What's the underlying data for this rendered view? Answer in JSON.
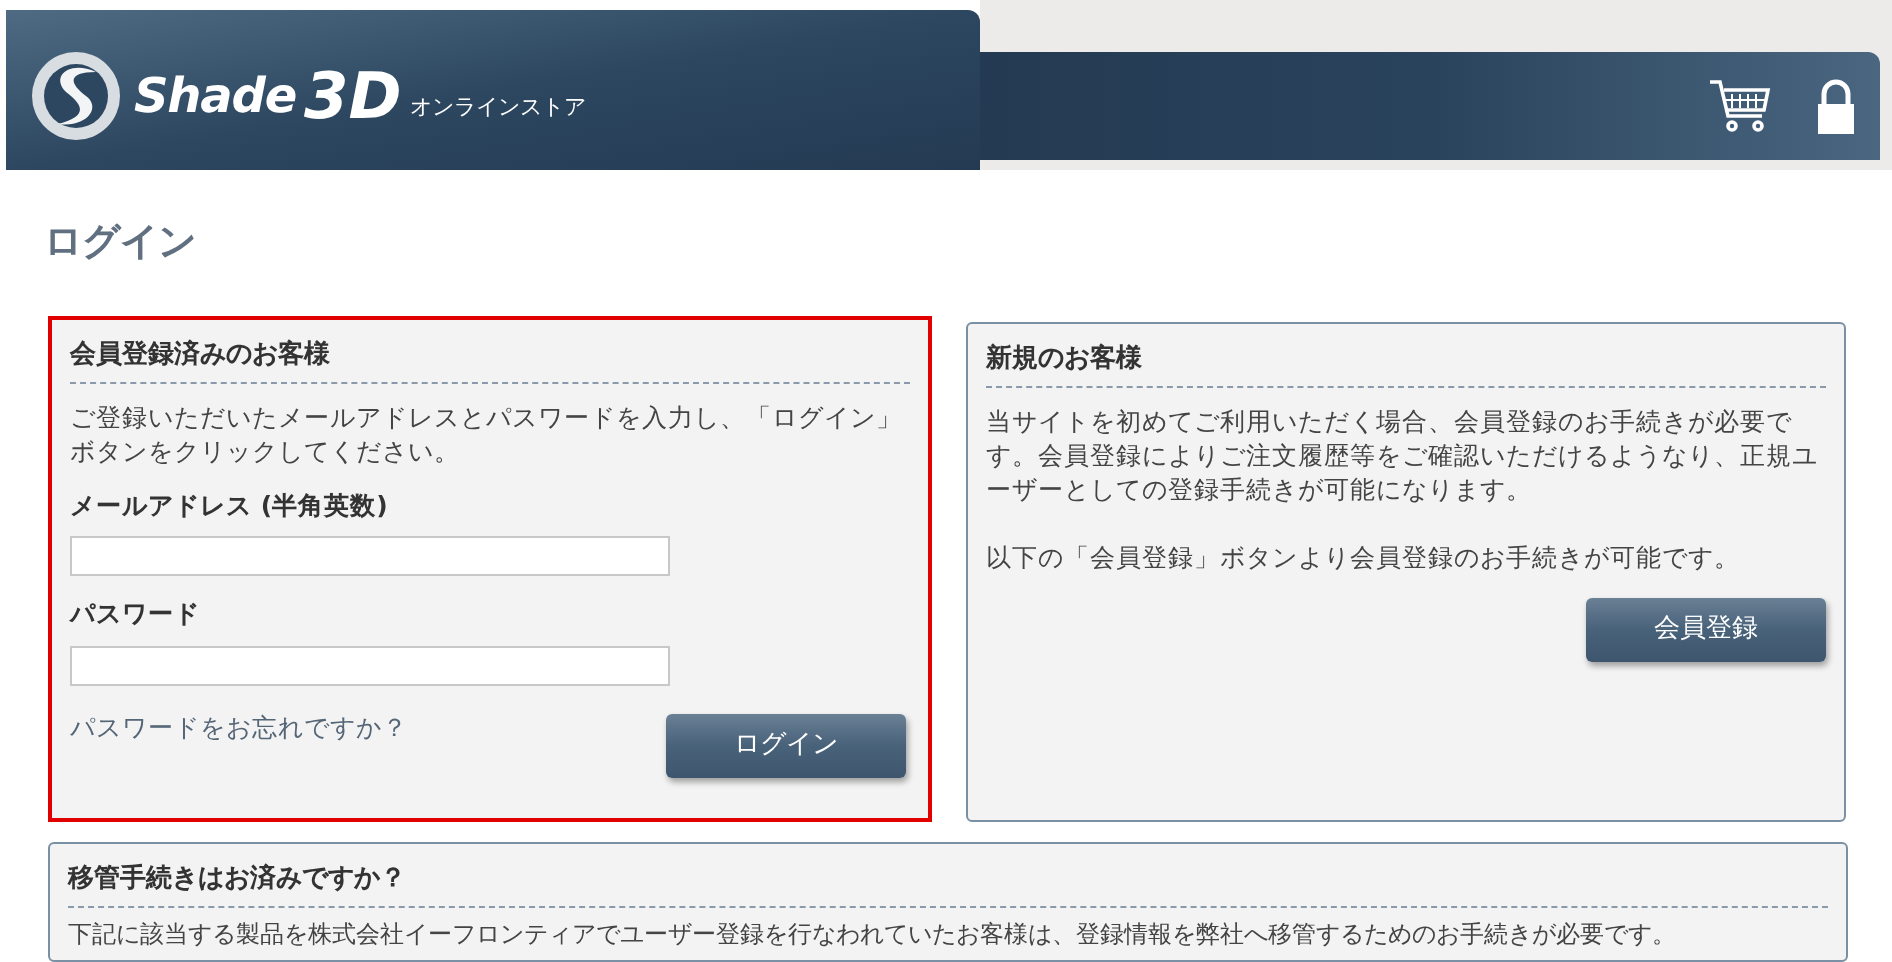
{
  "header": {
    "logo_text": "Shade",
    "logo_number": "3D",
    "logo_subtitle": "オンラインストア"
  },
  "page_title": "ログイン",
  "member_panel": {
    "title": "会員登録済みのお客様",
    "highlighted": true,
    "intro": "ご登録いただいたメールアドレスとパスワードを入力し、「ログイン」ボタンをクリックしてください。",
    "fields": [
      {
        "label": "メールアドレス (半角英数)"
      },
      {
        "label": "パスワード"
      }
    ],
    "forgot_link": "パスワードをお忘れですか？",
    "button": "ログイン"
  },
  "new_panel": {
    "title": "新規のお客様",
    "highlighted": false,
    "paragraphs": [
      "当サイトを初めてご利用いただく場合、会員登録のお手続きが必要です。会員登録によりご注文履歴等をご確認いただけるようなり、正規ユーザーとしての登録手続きが可能になります。",
      "以下の「会員登録」ボタンより会員登録のお手続きが可能です。"
    ],
    "button": "会員登録"
  },
  "transfer_panel": {
    "title": "移管手続きはお済みですか？",
    "text": "下記に該当する製品を株式会社イーフロンティアでユーザー登録を行なわれていたお客様は、登録情報を弊社へ移管するためのお手続きが必要です。"
  }
}
